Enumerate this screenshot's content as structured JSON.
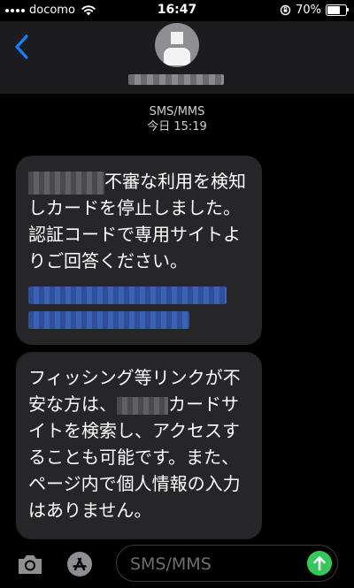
{
  "status_bar": {
    "carrier": "docomo",
    "time": "16:47",
    "battery": "70%",
    "battery_level": 0.7
  },
  "header": {
    "contact_name": ""
  },
  "conversation": {
    "service": "SMS/MMS",
    "timestamp": "今日 15:19"
  },
  "messages": [
    {
      "text": "不審な利用を検知しカードを停止しました。認証コードで専用サイトよりご回答ください。"
    },
    {
      "text_before": "フィッシング等リンクが不安な方は、",
      "text_after": "カードサイトを検索し、アクセスすることも可能です。また、ページ内で個人情報の入力はありません。"
    }
  ],
  "input": {
    "placeholder": "SMS/MMS"
  },
  "colors": {
    "accent": "#0a84ff",
    "send": "#34c759",
    "bubble": "#262628"
  }
}
